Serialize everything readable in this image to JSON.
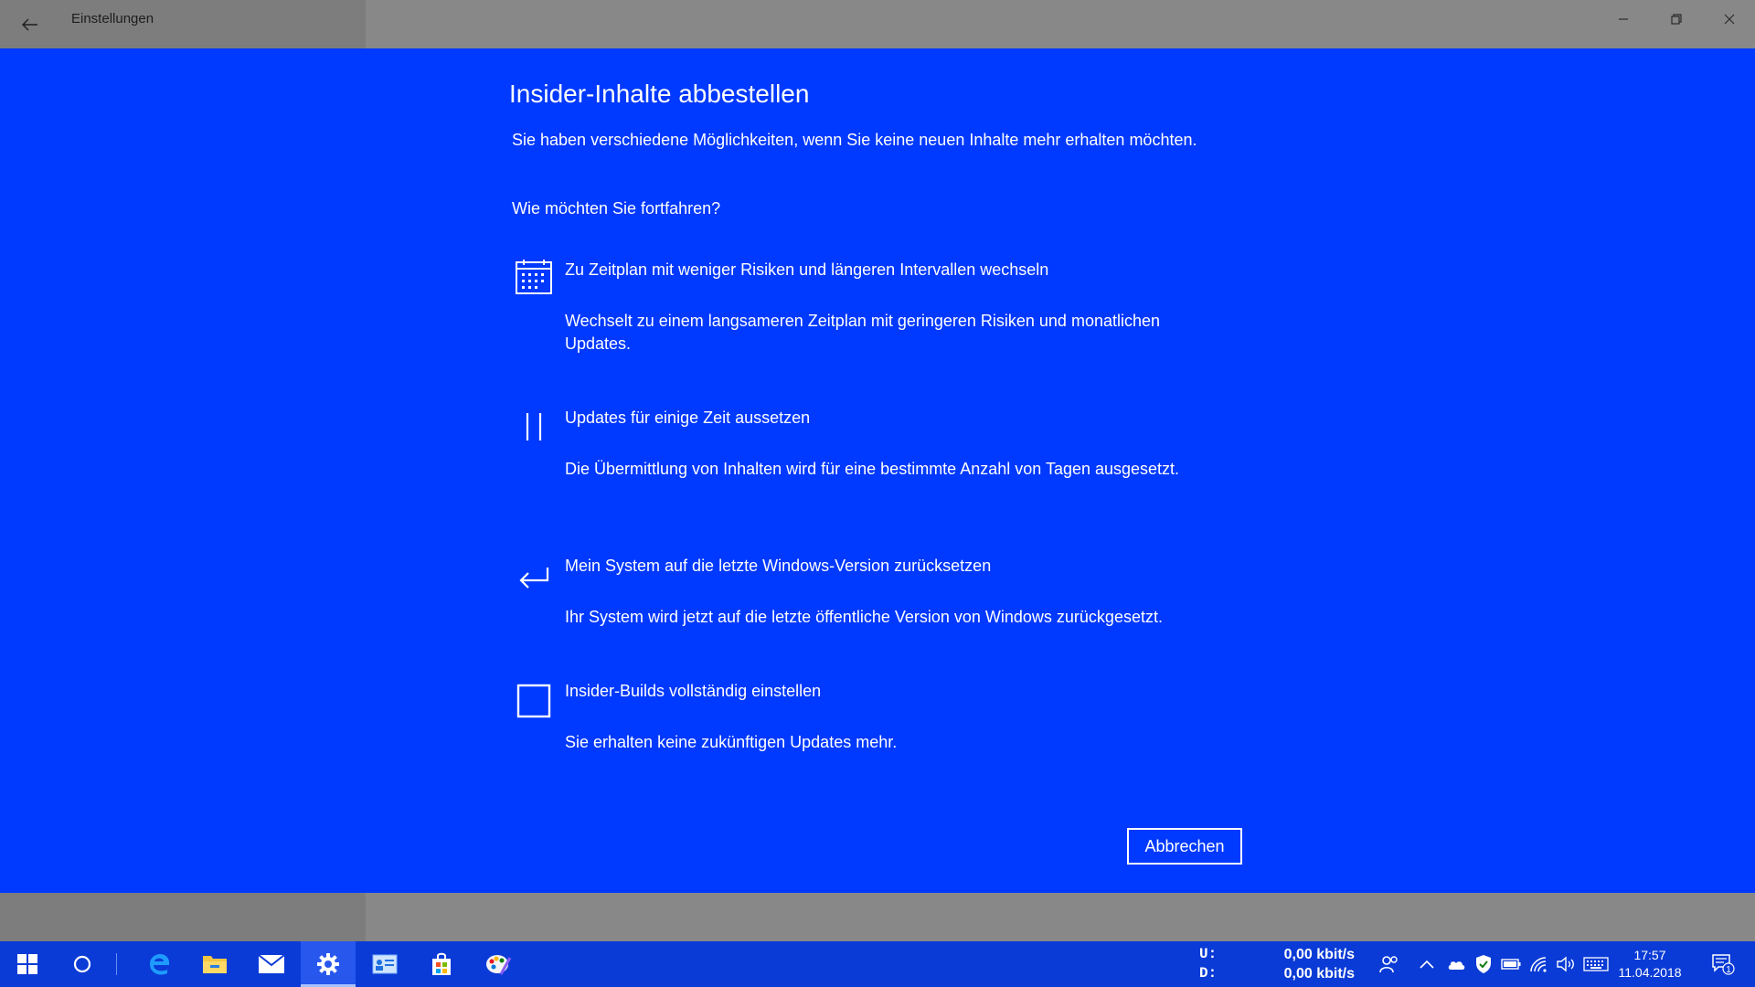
{
  "window": {
    "title": "Einstellungen"
  },
  "dialog": {
    "title": "Insider-Inhalte abbestellen",
    "intro": "Sie haben verschiedene Möglichkeiten, wenn Sie keine neuen Inhalte mehr erhalten möchten.",
    "question": "Wie möchten Sie fortfahren?",
    "options": [
      {
        "icon": "calendar-icon",
        "title": "Zu Zeitplan mit weniger Risiken und längeren Intervallen wechseln",
        "description": "Wechselt zu einem langsameren Zeitplan mit geringeren Risiken und monatlichen Updates."
      },
      {
        "icon": "pause-icon",
        "title": "Updates für einige Zeit aussetzen",
        "description": "Die Übermittlung von Inhalten wird für eine bestimmte Anzahl von Tagen ausgesetzt."
      },
      {
        "icon": "return-arrow-icon",
        "title": "Mein System auf die letzte Windows-Version zurücksetzen",
        "description": "Ihr System wird jetzt auf die letzte öffentliche Version von Windows zurückgesetzt."
      },
      {
        "icon": "stop-square-icon",
        "title": "Insider-Builds vollständig einstellen",
        "description": "Sie erhalten keine zukünftigen Updates mehr."
      }
    ],
    "cancel_label": "Abbrechen"
  },
  "taskbar": {
    "apps": [
      "start-icon",
      "cortana-icon",
      "edge-icon",
      "file-explorer-icon",
      "mail-icon",
      "settings-icon",
      "contact-card-icon",
      "store-icon",
      "paint-icon"
    ],
    "active_app": "settings-icon",
    "net_upload_label": "U:",
    "net_download_label": "D:",
    "net_upload_value": "0,00 kbit/s",
    "net_download_value": "0,00 kbit/s",
    "time": "17:57",
    "date": "11.04.2018",
    "notification_count": "1"
  }
}
